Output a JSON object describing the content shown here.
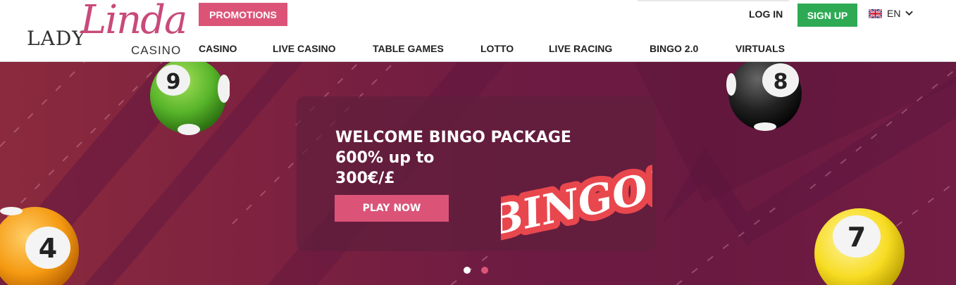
{
  "logo": {
    "lady": "LADY",
    "linda": "Linda",
    "casino": "CASINO"
  },
  "header": {
    "promotions_label": "PROMOTIONS",
    "login_label": "LOG IN",
    "signup_label": "SIGN UP",
    "language": "EN"
  },
  "nav": {
    "items": [
      {
        "label": "CASINO"
      },
      {
        "label": "LIVE CASINO"
      },
      {
        "label": "TABLE GAMES"
      },
      {
        "label": "LOTTO"
      },
      {
        "label": "LIVE RACING"
      },
      {
        "label": "BINGO 2.0"
      },
      {
        "label": "VIRTUALS"
      }
    ]
  },
  "hero": {
    "line1": "WELCOME BINGO PACKAGE",
    "line2": "600% up to",
    "line3": "300€/£",
    "cta_label": "PLAY NOW",
    "bingo_text": "BINGO!",
    "balls": [
      "9",
      "8",
      "4",
      "7"
    ],
    "slides": 2,
    "active_slide": 1
  },
  "colors": {
    "accent_pink": "#db5478",
    "signup_green": "#2eaa55",
    "hero_maroon": "#7c2140"
  }
}
